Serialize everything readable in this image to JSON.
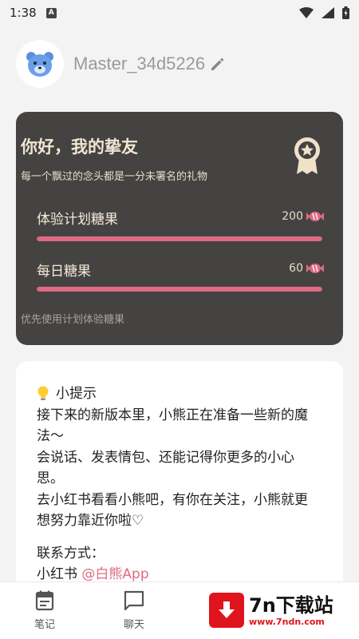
{
  "status_bar": {
    "time": "1:38",
    "app_icon_letter": "A"
  },
  "profile": {
    "username": "Master_34d5226"
  },
  "candy_card": {
    "title": "你好，我的挚友",
    "subtitle": "每一个飘过的念头都是一分未署名的礼物",
    "trial_candy": {
      "label": "体验计划糖果",
      "count": "200",
      "fill": 1.0
    },
    "daily_candy": {
      "label": "每日糖果",
      "count": "60",
      "fill": 1.0
    },
    "note": "优先使用计划体验糖果"
  },
  "tip_card": {
    "title": "小提示",
    "lines": [
      "接下来的新版本里，小熊正在准备一些新的魔",
      "法～",
      "会说话、发表情包、还能记得你更多的小心",
      "思。",
      "去小红书看看小熊吧，有你在关注，小熊就更",
      "想努力靠近你啦♡"
    ],
    "contact_label": "联系方式：",
    "contact_platform": "小红书",
    "contact_handle": "@白熊App"
  },
  "bottom_nav": {
    "items": [
      {
        "label": "笔记",
        "icon": "notebook-icon"
      },
      {
        "label": "聊天",
        "icon": "chat-icon"
      }
    ]
  },
  "watermark": {
    "brand": "7n下载站",
    "url": "www.7ndn.com"
  },
  "colors": {
    "accent_pink": "#e06a84",
    "card_dark": "#444342",
    "card_text": "#f1e6d3"
  }
}
